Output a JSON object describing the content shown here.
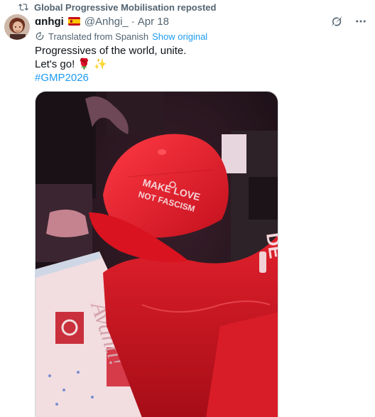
{
  "repost": {
    "label": "Global Progressive Mobilisation reposted",
    "icon": "repost-icon"
  },
  "author": {
    "display_name": "ɑnhgi",
    "flag": "Spain flag",
    "handle": "@Anhgi_",
    "separator": "·",
    "date": "Apr 18"
  },
  "translation": {
    "label": "Translated from Spanish",
    "link": "Show original",
    "icon": "translate-icon"
  },
  "tweet": {
    "line1": "Progressives of the world, unite.",
    "line2_text": "Let's go!",
    "line2_emoji_rose": "🌹",
    "line2_emoji_sparkle": "✨",
    "hashtag": "#GMP2026"
  },
  "media": {
    "cap_text_line1": "MAKE LOVE",
    "cap_text_line2": "NOT FASCISM",
    "magazine_text": "Avanti!",
    "colors": {
      "cap_red": "#e8202c",
      "background_dark": "#1d1419",
      "magazine_pink": "#f2dde0"
    }
  },
  "actions": {
    "grok_icon": "grok-icon",
    "more_icon": "more-icon"
  }
}
